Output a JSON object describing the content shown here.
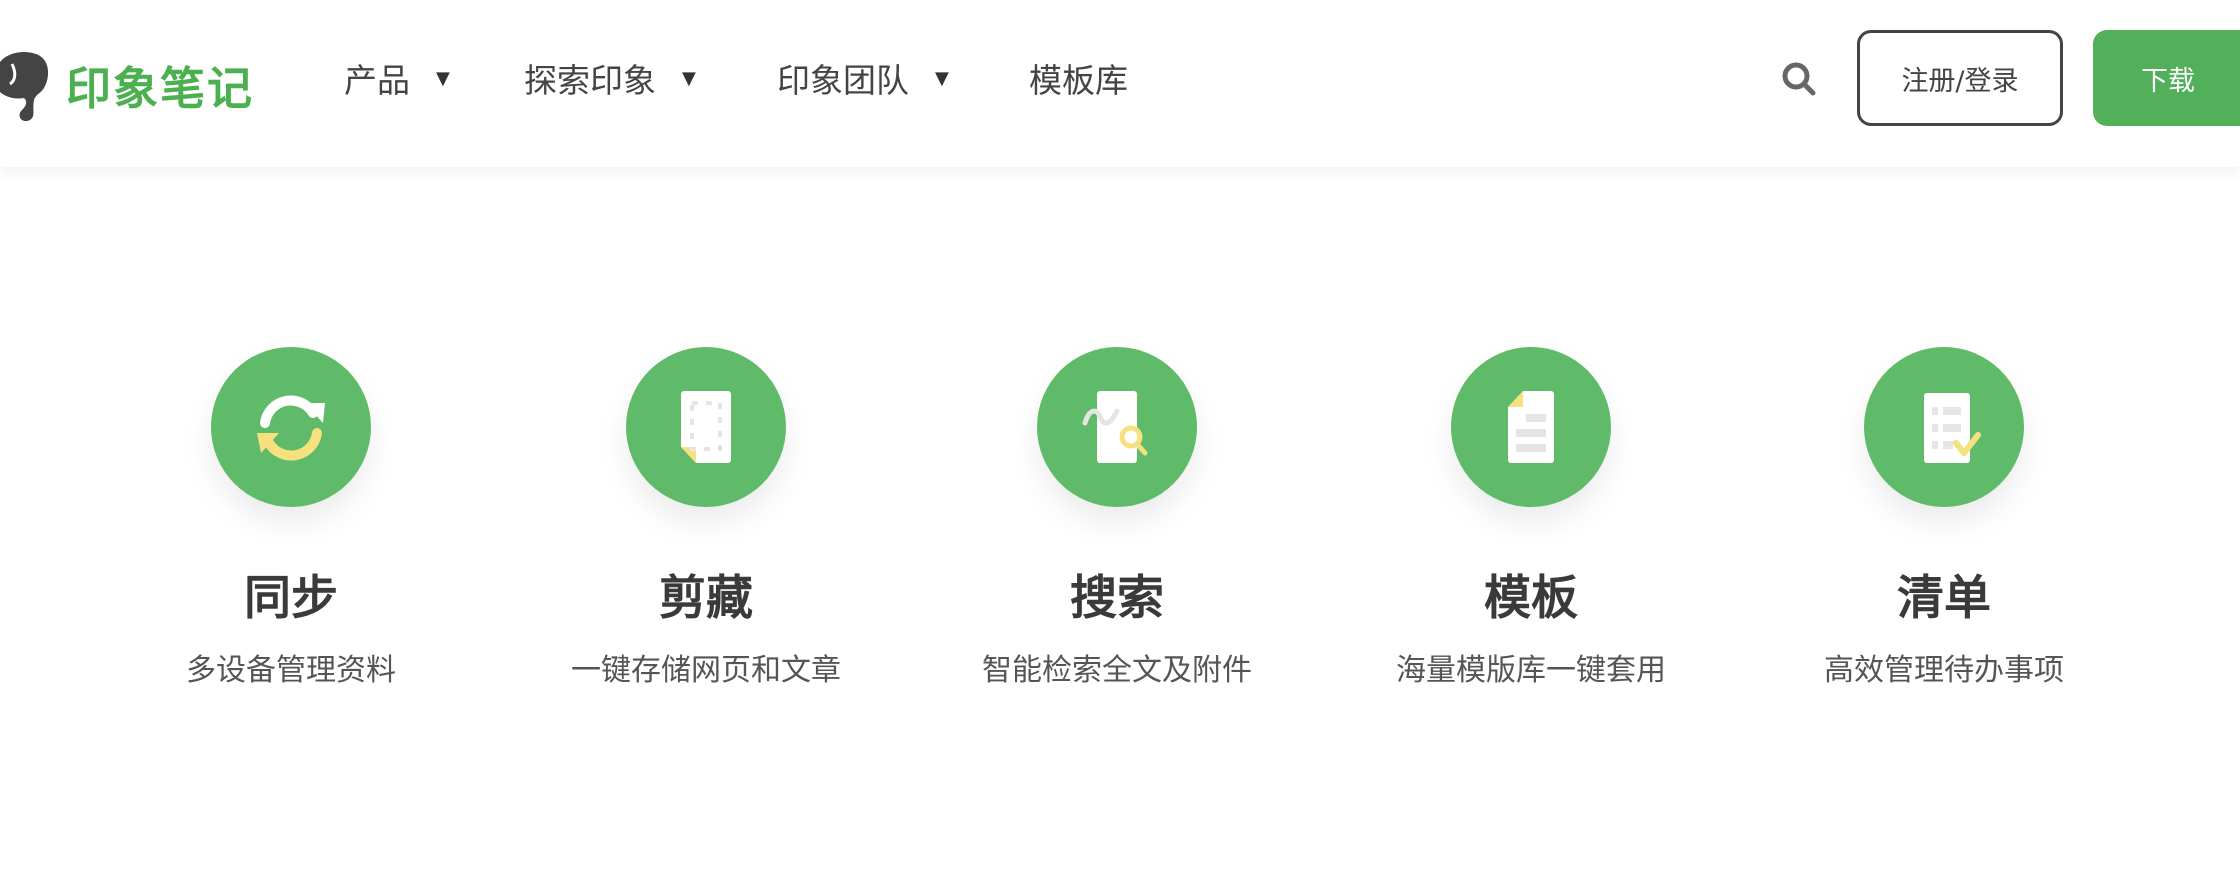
{
  "header": {
    "logo_text": "印象笔记",
    "nav": [
      {
        "label": "产品",
        "has_dropdown": true
      },
      {
        "label": "探索印象",
        "has_dropdown": true
      },
      {
        "label": "印象团队",
        "has_dropdown": true
      },
      {
        "label": "模板库",
        "has_dropdown": false
      }
    ],
    "caret": "▼",
    "search_icon": "search-icon",
    "login_label": "注册/登录",
    "download_label": "下载"
  },
  "features": [
    {
      "title": "同步",
      "desc": "多设备管理资料",
      "icon": "sync-icon"
    },
    {
      "title": "剪藏",
      "desc": "一键存储网页和文章",
      "icon": "clip-icon"
    },
    {
      "title": "搜索",
      "desc": "智能检索全文及附件",
      "icon": "search-doc-icon"
    },
    {
      "title": "模板",
      "desc": "海量模版库一键套用",
      "icon": "template-icon"
    },
    {
      "title": "清单",
      "desc": "高效管理待办事项",
      "icon": "checklist-icon"
    }
  ],
  "colors": {
    "brand": "#4caf50",
    "circle": "#5fba69",
    "accent_yellow": "#f7e07e"
  }
}
